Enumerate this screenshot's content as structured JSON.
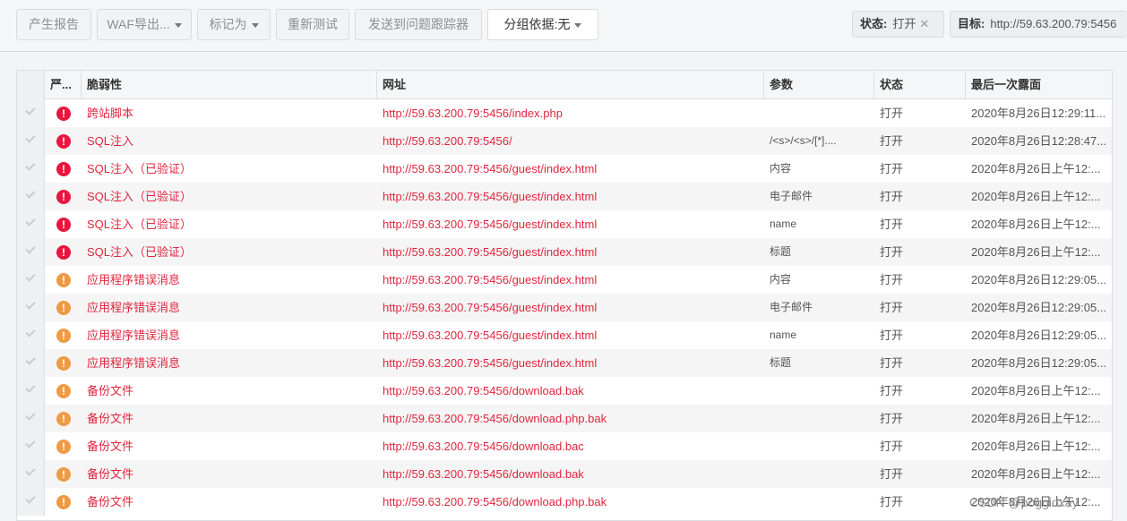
{
  "toolbar": {
    "report": "产生报告",
    "waf_export": "WAF导出...",
    "mark_as": "标记为",
    "retest": "重新测试",
    "send_tracker": "发送到问题跟踪器",
    "group_by_label": "分组依据:",
    "group_by_value": "无"
  },
  "filters": {
    "status_label": "状态:",
    "status_value": "打开",
    "target_label": "目标:",
    "target_value": "http://59.63.200.79:5456"
  },
  "table": {
    "columns": [
      "严...",
      "脆弱性",
      "网址",
      "参数",
      "状态",
      "最后一次露面"
    ],
    "rows": [
      {
        "severity": "high",
        "vuln": "跨站脚本",
        "url": "http://59.63.200.79:5456/index.php",
        "param": "",
        "status": "打开",
        "time": "2020年8月26日12:29:11..."
      },
      {
        "severity": "high",
        "vuln": "SQL注入",
        "url": "http://59.63.200.79:5456/",
        "param": "/<s>/<s>/[*]....",
        "status": "打开",
        "time": "2020年8月26日12:28:47..."
      },
      {
        "severity": "high",
        "vuln": "SQL注入（已验证）",
        "url": "http://59.63.200.79:5456/guest/index.html",
        "param": "内容",
        "status": "打开",
        "time": "2020年8月26日上午12:..."
      },
      {
        "severity": "high",
        "vuln": "SQL注入（已验证）",
        "url": "http://59.63.200.79:5456/guest/index.html",
        "param": "电子邮件",
        "status": "打开",
        "time": "2020年8月26日上午12:..."
      },
      {
        "severity": "high",
        "vuln": "SQL注入（已验证）",
        "url": "http://59.63.200.79:5456/guest/index.html",
        "param": "name",
        "status": "打开",
        "time": "2020年8月26日上午12:..."
      },
      {
        "severity": "high",
        "vuln": "SQL注入（已验证）",
        "url": "http://59.63.200.79:5456/guest/index.html",
        "param": "标题",
        "status": "打开",
        "time": "2020年8月26日上午12:..."
      },
      {
        "severity": "med",
        "vuln": "应用程序错误消息",
        "url": "http://59.63.200.79:5456/guest/index.html",
        "param": "内容",
        "status": "打开",
        "time": "2020年8月26日12:29:05..."
      },
      {
        "severity": "med",
        "vuln": "应用程序错误消息",
        "url": "http://59.63.200.79:5456/guest/index.html",
        "param": "电子邮件",
        "status": "打开",
        "time": "2020年8月26日12:29:05..."
      },
      {
        "severity": "med",
        "vuln": "应用程序错误消息",
        "url": "http://59.63.200.79:5456/guest/index.html",
        "param": "name",
        "status": "打开",
        "time": "2020年8月26日12:29:05..."
      },
      {
        "severity": "med",
        "vuln": "应用程序错误消息",
        "url": "http://59.63.200.79:5456/guest/index.html",
        "param": "标题",
        "status": "打开",
        "time": "2020年8月26日12:29:05..."
      },
      {
        "severity": "med",
        "vuln": "备份文件",
        "url": "http://59.63.200.79:5456/download.bak",
        "param": "",
        "status": "打开",
        "time": "2020年8月26日上午12:..."
      },
      {
        "severity": "med",
        "vuln": "备份文件",
        "url": "http://59.63.200.79:5456/download.php.bak",
        "param": "",
        "status": "打开",
        "time": "2020年8月26日上午12:..."
      },
      {
        "severity": "med",
        "vuln": "备份文件",
        "url": "http://59.63.200.79:5456/download.bac",
        "param": "",
        "status": "打开",
        "time": "2020年8月26日上午12:..."
      },
      {
        "severity": "med",
        "vuln": "备份文件",
        "url": "http://59.63.200.79:5456/download.bak",
        "param": "",
        "status": "打开",
        "time": "2020年8月26日上午12:..."
      },
      {
        "severity": "med",
        "vuln": "备份文件",
        "url": "http://59.63.200.79:5456/download.php.bak",
        "param": "",
        "status": "打开",
        "time": "2020年8月26日上午12:..."
      }
    ]
  },
  "watermark": "CSDN @poggioxay"
}
